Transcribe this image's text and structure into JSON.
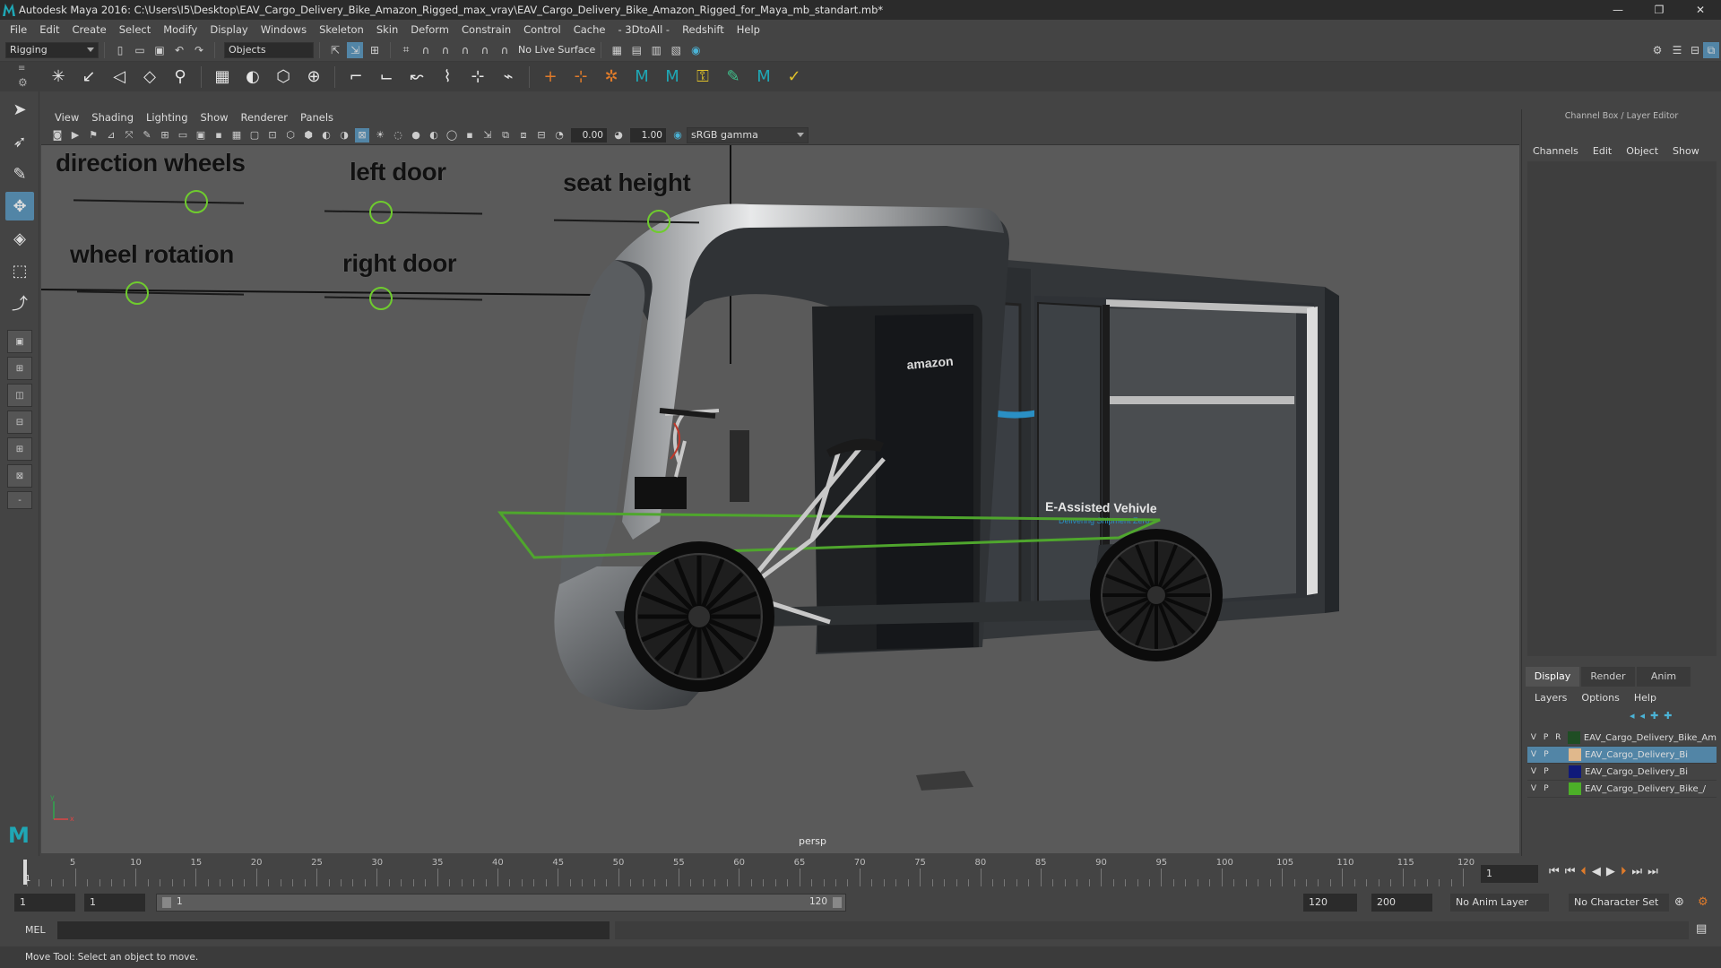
{
  "window": {
    "title": "Autodesk Maya 2016: C:\\Users\\I5\\Desktop\\EAV_Cargo_Delivery_Bike_Amazon_Rigged_max_vray\\EAV_Cargo_Delivery_Bike_Amazon_Rigged_for_Maya_mb_standart.mb*",
    "minimize": "—",
    "restore": "❐",
    "close": "✕"
  },
  "menubar": [
    "File",
    "Edit",
    "Create",
    "Select",
    "Modify",
    "Display",
    "Windows",
    "Skeleton",
    "Skin",
    "Deform",
    "Constrain",
    "Control",
    "Cache",
    "- 3DtoAll -",
    "Redshift",
    "Help"
  ],
  "statusline": {
    "mode": "Rigging",
    "selection_mask": "Objects",
    "live_surface": "No Live Surface"
  },
  "viewport": {
    "menus": [
      "View",
      "Shading",
      "Lighting",
      "Show",
      "Renderer",
      "Panels"
    ],
    "exposure": "0.00",
    "gamma": "1.00",
    "colorspace": "sRGB gamma",
    "camera": "persp",
    "controls": {
      "direction_wheels": "direction wheels",
      "left_door": "left door",
      "seat_height": "seat height",
      "wheel_rotation": "wheel rotation",
      "right_door": "right door"
    },
    "decals": {
      "brand": "amazon",
      "vehicle": "E-Assisted Vehivle",
      "tagline": "Delivering Shipment Zero"
    },
    "axis": {
      "x": "x",
      "y": "y"
    }
  },
  "rightpanel": {
    "header": "Channel Box / Layer Editor",
    "tabs": [
      "Channels",
      "Edit",
      "Object",
      "Show"
    ],
    "display_tabs": [
      "Display",
      "Render",
      "Anim"
    ],
    "layer_menus": [
      "Layers",
      "Options",
      "Help"
    ],
    "layers": [
      {
        "v": "V",
        "p": "P",
        "r": "R",
        "color": "#1f4d24",
        "name": "EAV_Cargo_Delivery_Bike_Am",
        "selected": false
      },
      {
        "v": "V",
        "p": "P",
        "r": "",
        "color": "#e0b88c",
        "name": "EAV_Cargo_Delivery_Bi",
        "selected": true
      },
      {
        "v": "V",
        "p": "P",
        "r": "",
        "color": "#101a7a",
        "name": "EAV_Cargo_Delivery_Bi",
        "selected": false
      },
      {
        "v": "V",
        "p": "P",
        "r": "",
        "color": "#4caf28",
        "name": "EAV_Cargo_Delivery_Bike_/",
        "selected": false
      }
    ]
  },
  "timeline": {
    "ticks": [
      "5",
      "10",
      "15",
      "20",
      "25",
      "30",
      "35",
      "40",
      "45",
      "50",
      "55",
      "60",
      "65",
      "70",
      "75",
      "80",
      "85",
      "90",
      "95",
      "100",
      "105",
      "110",
      "115",
      "120"
    ],
    "current_frame": "1",
    "current_field": "1"
  },
  "range": {
    "start": "1",
    "start2": "1",
    "slider_start": "1",
    "slider_end": "120",
    "end": "120",
    "end2": "200",
    "anim_layer": "No Anim Layer",
    "char_set": "No Character Set"
  },
  "mel": {
    "label": "MEL"
  },
  "help": "Move Tool: Select an object to move."
}
